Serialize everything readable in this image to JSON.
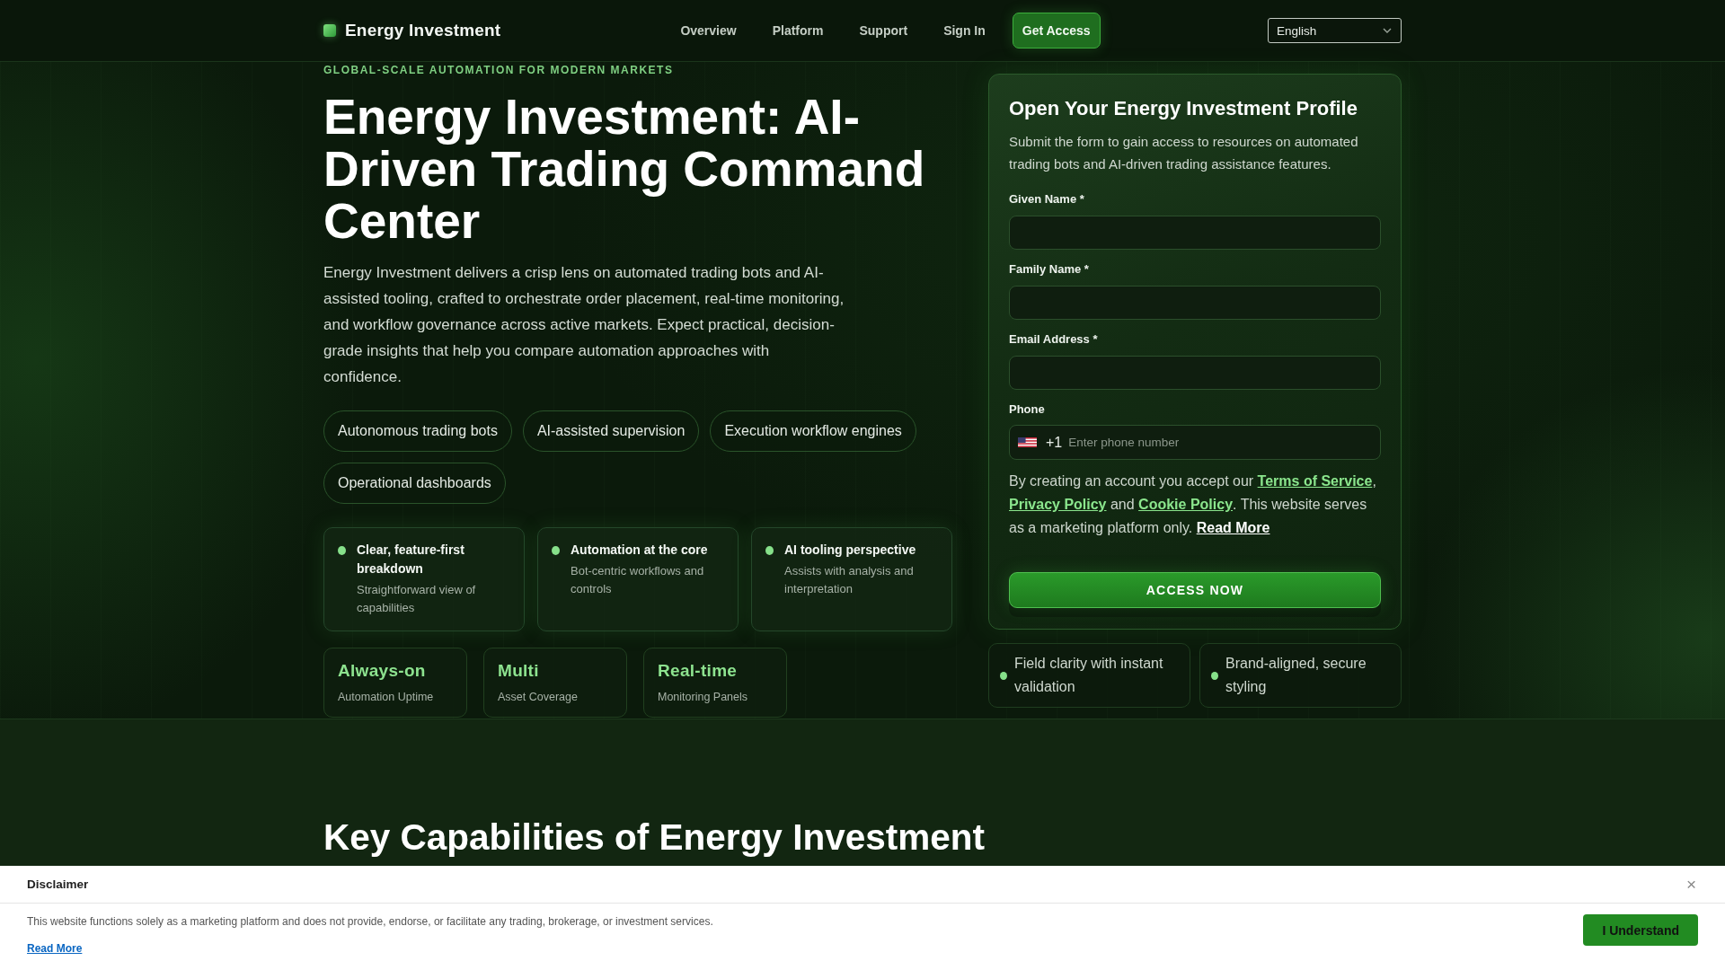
{
  "header": {
    "logo": "Energy Investment",
    "nav": [
      {
        "label": "Overview"
      },
      {
        "label": "Platform"
      },
      {
        "label": "Support"
      },
      {
        "label": "Sign In"
      }
    ],
    "cta": "Get Access",
    "language": "English"
  },
  "hero": {
    "eyebrow": "GLOBAL-SCALE AUTOMATION FOR MODERN MARKETS",
    "title": "Energy Investment: AI-Driven Trading Command Center",
    "description": "Energy Investment delivers a crisp lens on automated trading bots and AI-assisted tooling, crafted to orchestrate order placement, real-time monitoring, and workflow governance across active markets. Expect practical, decision-grade insights that help you compare automation approaches with confidence.",
    "tags": [
      "Autonomous trading bots",
      "AI-assisted supervision",
      "Execution workflow engines",
      "Operational dashboards"
    ],
    "features": [
      {
        "title": "Clear, feature-first breakdown",
        "description": "Straightforward view of capabilities"
      },
      {
        "title": "Automation at the core",
        "description": "Bot-centric workflows and controls"
      },
      {
        "title": "AI tooling perspective",
        "description": "Assists with analysis and interpretation"
      }
    ],
    "stats": [
      {
        "value": "Always-on",
        "label": "Automation Uptime"
      },
      {
        "value": "Multi",
        "label": "Asset Coverage"
      },
      {
        "value": "Real-time",
        "label": "Monitoring Panels"
      }
    ]
  },
  "signup_form": {
    "title": "Open Your Energy Investment Profile",
    "subtitle": "Submit the form to gain access to resources on automated trading bots and AI-driven trading assistance features.",
    "fields": [
      {
        "label": "Given Name *",
        "kind": "text"
      },
      {
        "label": "Family Name *",
        "kind": "text"
      },
      {
        "label": "Email Address *",
        "kind": "text"
      },
      {
        "label": "Phone",
        "kind": "phone",
        "dial_code": "+1",
        "placeholder": "Enter phone number"
      }
    ],
    "consent": [
      {
        "kind": "text",
        "text": "By creating an account you accept our "
      },
      {
        "kind": "link",
        "text": "Terms of Service"
      },
      {
        "kind": "text",
        "text": ", "
      },
      {
        "kind": "link",
        "text": "Privacy Policy"
      },
      {
        "kind": "text",
        "text": " and "
      },
      {
        "kind": "link",
        "text": "Cookie Policy"
      },
      {
        "kind": "text",
        "text": ". This website serves as a marketing platform only. "
      },
      {
        "kind": "more",
        "text": "Read More"
      }
    ],
    "submit": "ACCESS NOW"
  },
  "form_highlights": [
    "Field clarity with instant validation",
    "Brand-aligned, secure styling"
  ],
  "capabilities": {
    "title": "Key Capabilities of Energy Investment"
  },
  "disclaimer": {
    "title": "Disclaimer",
    "close": "×",
    "text": "This website functions solely as a marketing platform and does not provide, endorse, or facilitate any trading, brokerage, or investment services.",
    "link": "Read More",
    "button": "I Understand"
  }
}
